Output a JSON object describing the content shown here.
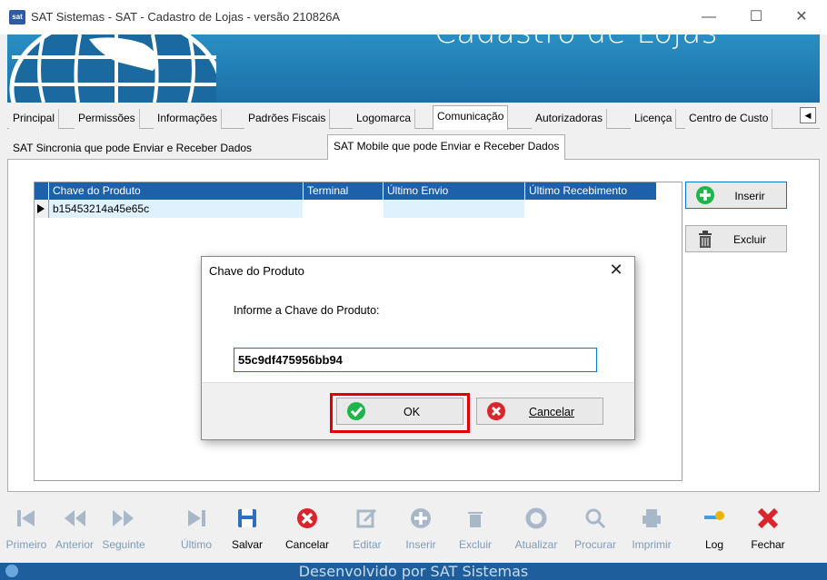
{
  "window": {
    "title": "SAT Sistemas - SAT - Cadastro de Lojas - versão 210826A",
    "app_icon_text": "sat",
    "minimize": "—",
    "maximize": "☐",
    "close": "✕"
  },
  "banner": {
    "title": "Cadastro de Lojas"
  },
  "tabs": [
    {
      "label": "Principal"
    },
    {
      "label": "Permissões"
    },
    {
      "label": "Informações"
    },
    {
      "label": "Padrões Fiscais"
    },
    {
      "label": "Logomarca"
    },
    {
      "label": "Comunicação"
    },
    {
      "label": "Autorizadoras"
    },
    {
      "label": "Licença"
    },
    {
      "label": "Centro de Custo"
    }
  ],
  "tab_scroll": "◀",
  "subtabs": [
    {
      "label": "SAT Sincronia que pode Enviar e Receber Dados"
    },
    {
      "label": "SAT Mobile que pode Enviar e Receber Dados"
    }
  ],
  "grid": {
    "columns": [
      "Chave do Produto",
      "Terminal",
      "Último Envio",
      "Último Recebimento"
    ],
    "rows": [
      [
        "b15453214a45e65c",
        "",
        "",
        ""
      ]
    ]
  },
  "side_buttons": {
    "insert": "Inserir",
    "delete": "Excluir"
  },
  "dialog": {
    "title": "Chave do Produto",
    "close": "✕",
    "prompt": "Informe a Chave do Produto:",
    "input_value": "55c9df475956bb94",
    "ok": "OK",
    "cancel": "Cancelar"
  },
  "toolbar": [
    {
      "label": "Primeiro",
      "icon": "first-icon",
      "enabled": false
    },
    {
      "label": "Anterior",
      "icon": "prev-icon",
      "enabled": false
    },
    {
      "label": "Seguinte",
      "icon": "next-icon",
      "enabled": false
    },
    {
      "label": "Último",
      "icon": "last-icon",
      "enabled": false
    },
    {
      "label": "Salvar",
      "icon": "save-icon",
      "enabled": true
    },
    {
      "label": "Cancelar",
      "icon": "cancel-icon",
      "enabled": true
    },
    {
      "label": "Editar",
      "icon": "edit-icon",
      "enabled": false
    },
    {
      "label": "Inserir",
      "icon": "insert-icon",
      "enabled": false
    },
    {
      "label": "Excluir",
      "icon": "delete-icon",
      "enabled": false
    },
    {
      "label": "Atualizar",
      "icon": "refresh-icon",
      "enabled": false
    },
    {
      "label": "Procurar",
      "icon": "search-icon",
      "enabled": false
    },
    {
      "label": "Imprimir",
      "icon": "print-icon",
      "enabled": false
    },
    {
      "label": "Log",
      "icon": "key-icon",
      "enabled": true
    },
    {
      "label": "Fechar",
      "icon": "close-icon",
      "enabled": true
    }
  ],
  "footer": {
    "text": "Desenvolvido por SAT Sistemas"
  },
  "colors": {
    "banner": "#1b6fa6",
    "grid_header": "#1c61aa",
    "selected_row": "#dff1fd",
    "highlight": "#e00000",
    "green_icon": "#1fb54a",
    "red_icon": "#d9262c"
  }
}
